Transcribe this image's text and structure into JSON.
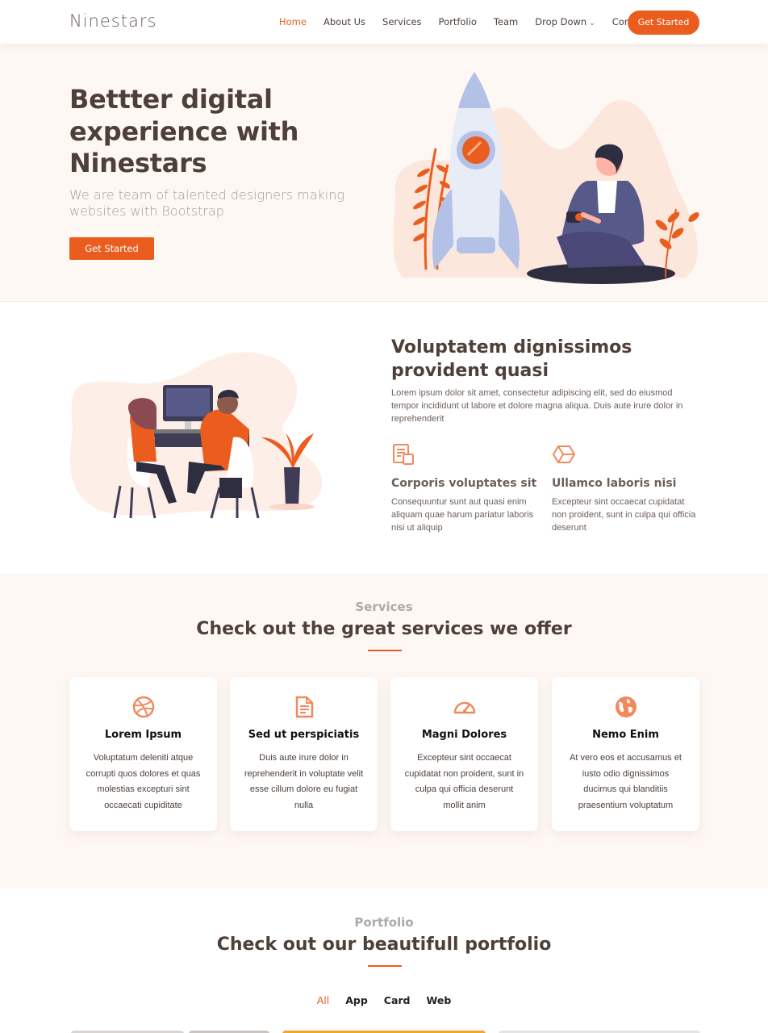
{
  "header": {
    "logo": "Ninestars",
    "nav": [
      {
        "label": "Home",
        "active": true
      },
      {
        "label": "About Us",
        "active": false
      },
      {
        "label": "Services",
        "active": false
      },
      {
        "label": "Portfolio",
        "active": false
      },
      {
        "label": "Team",
        "active": false
      },
      {
        "label": "Drop Down",
        "active": false,
        "dropdown": true
      },
      {
        "label": "Contact",
        "active": false
      }
    ],
    "cta": "Get Started"
  },
  "hero": {
    "title": "Bettter digital experience with Ninestars",
    "subtitle": "We are team of talented designers making websites with Bootstrap",
    "cta": "Get Started"
  },
  "about": {
    "title": "Voluptatem dignissimos provident quasi",
    "description": "Lorem ipsum dolor sit amet, consectetur adipiscing elit, sed do eiusmod tempor incididunt ut labore et dolore magna aliqua. Duis aute irure dolor in reprehenderit",
    "features": [
      {
        "icon": "receipt-icon",
        "title": "Corporis voluptates sit",
        "text": "Consequuntur sunt aut quasi enim aliquam quae harum pariatur laboris nisi ut aliquip"
      },
      {
        "icon": "cube-icon",
        "title": "Ullamco laboris nisi",
        "text": "Excepteur sint occaecat cupidatat non proident, sunt in culpa qui officia deserunt"
      }
    ]
  },
  "services": {
    "label": "Services",
    "title": "Check out the great services we offer",
    "cards": [
      {
        "icon": "dribbble-icon",
        "title": "Lorem Ipsum",
        "text": "Voluptatum deleniti atque corrupti quos dolores et quas molestias excepturi sint occaecati cupiditate"
      },
      {
        "icon": "file-icon",
        "title": "Sed ut perspiciatis",
        "text": "Duis aute irure dolor in reprehenderit in voluptate velit esse cillum dolore eu fugiat nulla"
      },
      {
        "icon": "speedometer-icon",
        "title": "Magni Dolores",
        "text": "Excepteur sint occaecat cupidatat non proident, sunt in culpa qui officia deserunt mollit anim"
      },
      {
        "icon": "globe-icon",
        "title": "Nemo Enim",
        "text": "At vero eos et accusamus et iusto odio dignissimos ducimus qui blanditiis praesentium voluptatum"
      }
    ]
  },
  "portfolio": {
    "label": "Portfolio",
    "title": "Check out our beautifull portfolio",
    "filters": [
      {
        "label": "All",
        "active": true
      },
      {
        "label": "App",
        "active": false
      },
      {
        "label": "Card",
        "active": false
      },
      {
        "label": "Web",
        "active": false
      }
    ]
  },
  "colors": {
    "accent": "#eb5d1e",
    "heading": "#4e4039",
    "hero_bg": "#fef8f5"
  }
}
